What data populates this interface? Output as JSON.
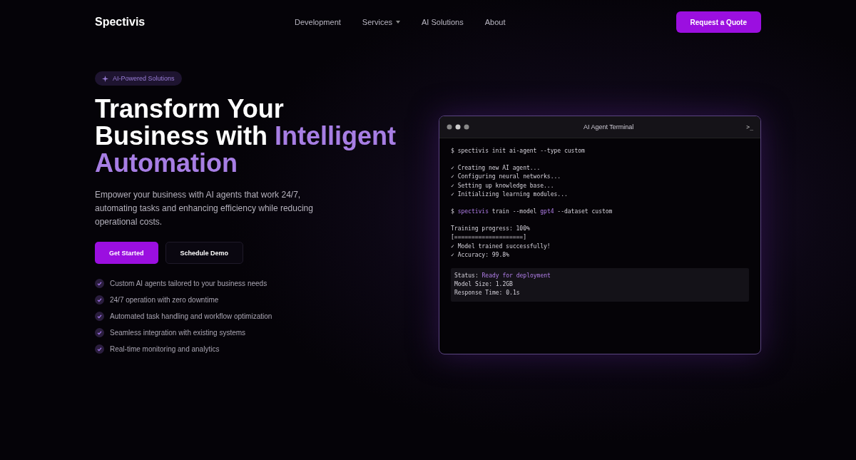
{
  "header": {
    "logo": "Spectivis",
    "nav": [
      {
        "label": "Development",
        "has_menu": false
      },
      {
        "label": "Services",
        "has_menu": true
      },
      {
        "label": "AI Solutions",
        "has_menu": false
      },
      {
        "label": "About",
        "has_menu": false
      }
    ],
    "cta": "Request a Quote"
  },
  "hero": {
    "badge": "AI-Powered Solutions",
    "title_lines": [
      [
        {
          "text": "Transform Your",
          "highlight": false
        }
      ],
      [
        {
          "text": "Business with ",
          "highlight": false
        },
        {
          "text": "Intelligent",
          "highlight": true
        }
      ],
      [
        {
          "text": "Automation",
          "highlight": true
        }
      ]
    ],
    "description": "Empower your business with AI agents that work 24/7, automating tasks and enhancing efficiency while reducing operational costs.",
    "buttons": [
      {
        "label": "Get Started",
        "kind": "primary"
      },
      {
        "label": "Schedule Demo",
        "kind": "secondary"
      }
    ],
    "features": [
      "Custom AI agents tailored to your business needs",
      "24/7 operation with zero downtime",
      "Automated task handling and workflow optimization",
      "Seamless integration with existing systems",
      "Real-time monitoring and analytics"
    ]
  },
  "terminal": {
    "title": "AI Agent Terminal",
    "prompt_icon": ">_",
    "blocks": [
      {
        "kind": "command",
        "lines": [
          [
            {
              "text": "$ spectivis init ai-agent --type custom",
              "highlight": false
            }
          ]
        ]
      },
      {
        "kind": "output",
        "lines": [
          [
            {
              "text": "✓ Creating new AI agent...",
              "highlight": false
            }
          ],
          [
            {
              "text": "✓ Configuring neural networks...",
              "highlight": false
            }
          ],
          [
            {
              "text": "✓ Setting up knowledge base...",
              "highlight": false
            }
          ],
          [
            {
              "text": "✓ Initializing learning modules...",
              "highlight": false
            }
          ]
        ]
      },
      {
        "kind": "command",
        "lines": [
          [
            {
              "text": "$ ",
              "highlight": false
            },
            {
              "text": "spectivis",
              "highlight": true
            },
            {
              "text": " train --model ",
              "highlight": false
            },
            {
              "text": "gpt4",
              "highlight": true
            },
            {
              "text": " --dataset custom",
              "highlight": false
            }
          ]
        ]
      },
      {
        "kind": "output",
        "lines": [
          [
            {
              "text": "Training progress: 100%",
              "highlight": false
            }
          ],
          [
            {
              "text": "[====================]",
              "highlight": false
            }
          ],
          [
            {
              "text": "✓ Model trained successfully!",
              "highlight": false
            }
          ],
          [
            {
              "text": "✓ Accuracy: 99.8%",
              "highlight": false
            }
          ]
        ]
      },
      {
        "kind": "status",
        "lines": [
          [
            {
              "text": "Status: ",
              "highlight": false
            },
            {
              "text": "Ready for deployment",
              "highlight": true
            }
          ],
          [
            {
              "text": "Model Size: 1.2GB",
              "highlight": false
            }
          ],
          [
            {
              "text": "Response Time: 0.1s",
              "highlight": false
            }
          ]
        ]
      }
    ]
  }
}
